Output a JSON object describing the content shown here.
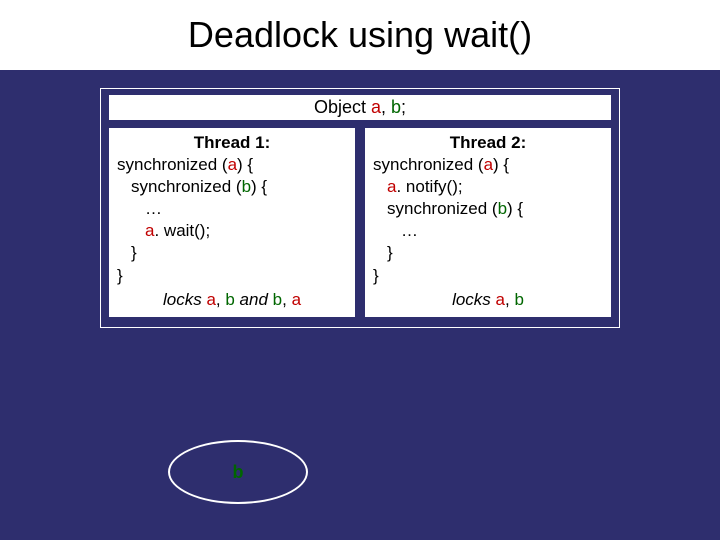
{
  "title": "Deadlock using wait()",
  "object_decl": {
    "prefix": "Object ",
    "a": "a",
    "sep": ", ",
    "b": "b",
    "suffix": ";"
  },
  "thread1": {
    "title": "Thread 1:",
    "l1a": "synchronized (",
    "l1b": "a",
    "l1c": ") {",
    "l2a": "synchronized (",
    "l2b": "b",
    "l2c": ") {",
    "l3": "…",
    "l4a": "a",
    "l4b": ". wait();",
    "l5": "}",
    "l6": "}",
    "locks_prefix": "locks ",
    "locks_a1": "a",
    "locks_s1": ", ",
    "locks_b1": "b",
    "locks_and": " and ",
    "locks_b2": "b",
    "locks_s2": ", ",
    "locks_a2": "a"
  },
  "thread2": {
    "title": "Thread 2:",
    "l1a": "synchronized (",
    "l1b": "a",
    "l1c": ") {",
    "l2a": "a",
    "l2b": ". notify();",
    "l3a": "synchronized (",
    "l3b": "b",
    "l3c": ") {",
    "l4": "…",
    "l5": "}",
    "l6": "}",
    "locks_prefix": "locks ",
    "locks_a": "a",
    "locks_s": ", ",
    "locks_b": "b"
  },
  "ellipse_label": "b"
}
